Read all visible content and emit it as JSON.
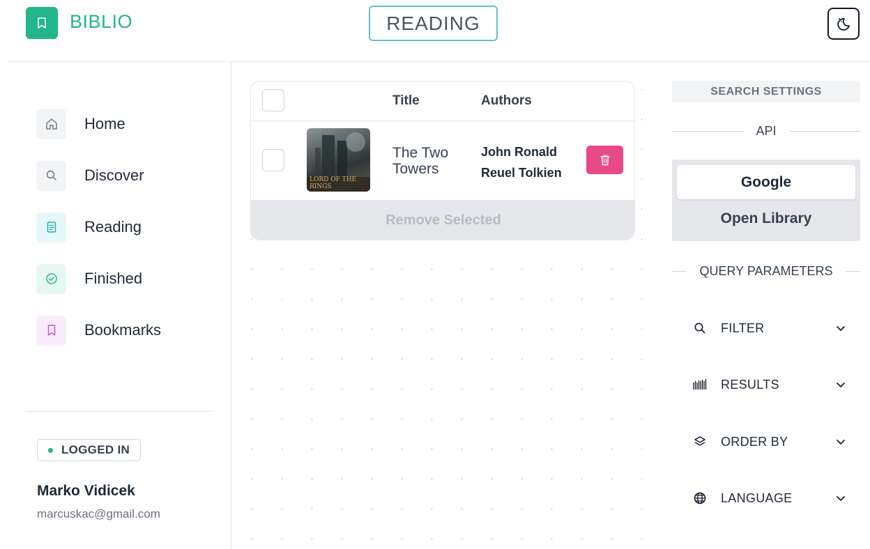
{
  "app": {
    "name": "BIBLIO",
    "page_title": "READING"
  },
  "colors": {
    "accent": "#22b58a",
    "title_border": "#5fc4c7",
    "danger": "#e84a86"
  },
  "header": {
    "logo_icon": "bookmark-icon",
    "theme_toggle_icon": "moon-icon"
  },
  "sidebar": {
    "items": [
      {
        "label": "Home",
        "icon": "home-icon",
        "icon_bg": "#f3f4f6"
      },
      {
        "label": "Discover",
        "icon": "search-icon",
        "icon_bg": "#f3f4f6"
      },
      {
        "label": "Reading",
        "icon": "document-icon",
        "icon_bg": "#e6f7f8"
      },
      {
        "label": "Finished",
        "icon": "check-circle-icon",
        "icon_bg": "#e7f8f1"
      },
      {
        "label": "Bookmarks",
        "icon": "bookmark-icon",
        "icon_bg": "#f8ecfb"
      }
    ],
    "status": "LOGGED IN",
    "user": {
      "name": "Marko Vidicek",
      "email": "marcuskac@gmail.com"
    }
  },
  "table": {
    "headers": {
      "title": "Title",
      "authors": "Authors"
    },
    "rows": [
      {
        "title": "The Two Towers",
        "authors": "John Ronald Reuel Tolkien",
        "cover_text": "LORD OF THE RINGS"
      }
    ],
    "remove_label": "Remove Selected"
  },
  "settings": {
    "heading": "SEARCH SETTINGS",
    "api_label": "API",
    "api_options": [
      "Google",
      "Open Library"
    ],
    "api_selected": "Google",
    "query_label": "QUERY PARAMETERS",
    "params": [
      {
        "label": "FILTER",
        "icon": "search-icon"
      },
      {
        "label": "RESULTS",
        "icon": "barcode-icon"
      },
      {
        "label": "ORDER BY",
        "icon": "layers-icon"
      },
      {
        "label": "LANGUAGE",
        "icon": "globe-icon"
      }
    ]
  }
}
